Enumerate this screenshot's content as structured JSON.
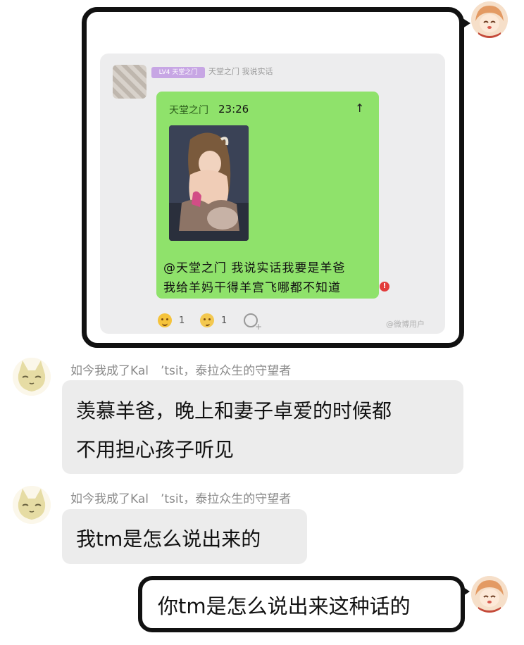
{
  "messages": [
    {
      "type": "outgoing-quote",
      "quote": {
        "level_tag": "LV4 天堂之门",
        "sender_name": "天堂之门 我说实话",
        "reply": {
          "name": "天堂之门",
          "time": "23:26",
          "arrow": "↑"
        },
        "text_line1": "@天堂之门 我说实话我要是羊爸",
        "text_line2": "我给羊妈干得羊宫飞哪都不知道",
        "error_mark": "!",
        "reactions": [
          {
            "icon": "laugh-emoji-icon",
            "count": "1"
          },
          {
            "icon": "awkward-emoji-icon",
            "count": "1"
          },
          {
            "icon": "add-reaction-icon",
            "count": ""
          }
        ],
        "watermark": "@微博用户"
      }
    },
    {
      "type": "incoming",
      "sender": "如今我成了Kal　’tsit，泰拉众生的守望者",
      "line1": "羡慕羊爸，晚上和妻子卓爱的时候都",
      "line2": "不用担心孩子听见"
    },
    {
      "type": "incoming",
      "sender": "如今我成了Kal　’tsit，泰拉众生的守望者",
      "line1": "我tm是怎么说出来的"
    },
    {
      "type": "outgoing",
      "text": "你tm是怎么说出来这种话的"
    }
  ],
  "colors": {
    "green_bubble": "#8fe26b",
    "incoming_bubble": "#ececec",
    "name_gray": "#8a8a8a"
  }
}
